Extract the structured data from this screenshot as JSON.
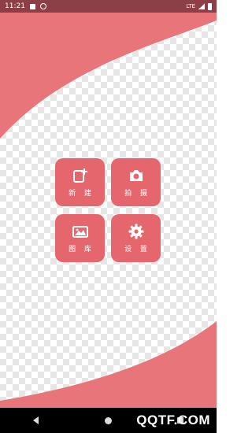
{
  "status_bar": {
    "time": "11:21",
    "network": "LTE",
    "left_icons": [
      "sim-icon",
      "notification-icon"
    ],
    "right_icons": [
      "signal-icon",
      "battery-icon"
    ]
  },
  "menu": {
    "tiles": [
      {
        "label": "新 建",
        "icon": "add-icon"
      },
      {
        "label": "拍 摄",
        "icon": "camera-icon"
      },
      {
        "label": "图 库",
        "icon": "gallery-icon"
      },
      {
        "label": "设 置",
        "icon": "gear-icon"
      }
    ]
  },
  "nav_bar": {
    "buttons": [
      "back-icon",
      "home-icon",
      "recent-apps-icon"
    ]
  },
  "watermark": "QQTF.COM",
  "colors": {
    "status_bar": "#8c3f46",
    "accent": "#e5676d",
    "wave": "#e8757a",
    "nav_bar": "#000000"
  }
}
